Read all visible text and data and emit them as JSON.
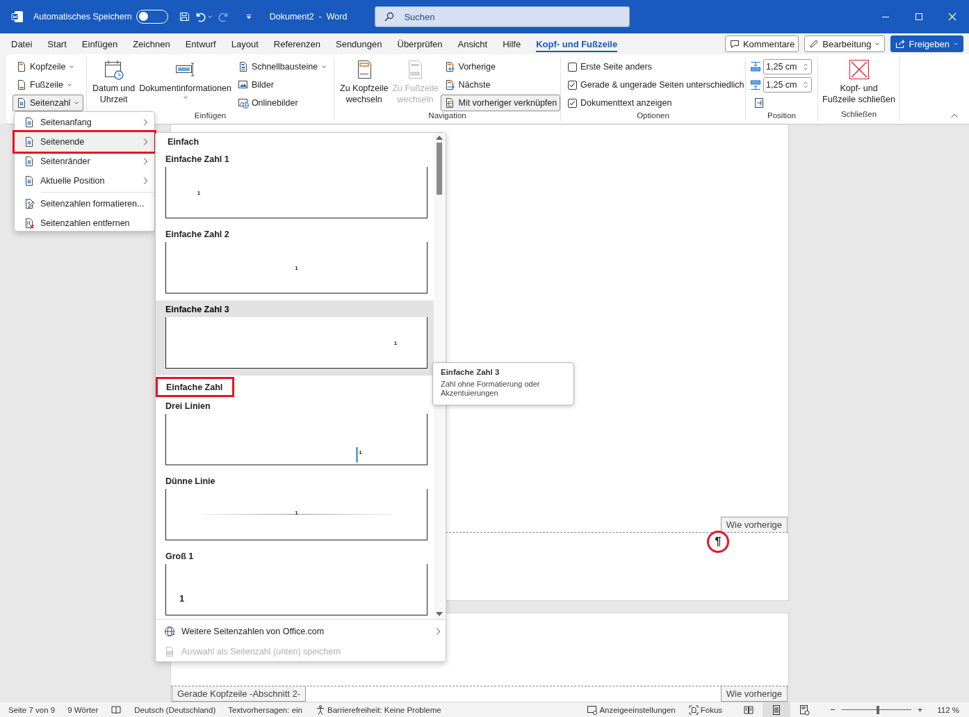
{
  "title_bar": {
    "autosave_label": "Automatisches Speichern",
    "autosave_on": false,
    "redo_disabled": true,
    "document_title": "Dokument2  -  Word",
    "search": {
      "placeholder": "Suchen"
    }
  },
  "ribbon_tabs": [
    {
      "label": "Datei",
      "selected": false
    },
    {
      "label": "Start",
      "selected": false
    },
    {
      "label": "Einfügen",
      "selected": false
    },
    {
      "label": "Zeichnen",
      "selected": false
    },
    {
      "label": "Entwurf",
      "selected": false
    },
    {
      "label": "Layout",
      "selected": false
    },
    {
      "label": "Referenzen",
      "selected": false
    },
    {
      "label": "Sendungen",
      "selected": false
    },
    {
      "label": "Überprüfen",
      "selected": false
    },
    {
      "label": "Ansicht",
      "selected": false
    },
    {
      "label": "Hilfe",
      "selected": false
    },
    {
      "label": "Kopf- und Fußzeile",
      "selected": true
    }
  ],
  "tab_buttons": [
    {
      "label": "Kommentare",
      "kind": "outline"
    },
    {
      "label": "Bearbeitung",
      "kind": "dropdown"
    },
    {
      "label": "Freigeben",
      "kind": "primary"
    }
  ],
  "ribbon_groups": [
    {
      "items": [
        {
          "kind": "small",
          "label": "Kopfzeile",
          "dropdown": true,
          "pressed": false
        },
        {
          "kind": "small",
          "label": "Fußzeile",
          "dropdown": true,
          "pressed": false
        },
        {
          "kind": "small",
          "label": "Seitenzahl",
          "dropdown": true,
          "pressed": true
        }
      ]
    },
    {
      "label": "Einfügen",
      "items": [
        {
          "kind": "large",
          "label": "Datum und\nUhrzeit",
          "dropdown": false,
          "disabled": false
        },
        {
          "kind": "large",
          "label": "Dokumentinformationen",
          "dropdown": true,
          "disabled": false
        },
        {
          "kind": "small",
          "label": "Schnellbausteine",
          "dropdown": true,
          "pressed": false
        },
        {
          "kind": "small",
          "label": "Bilder",
          "dropdown": false,
          "pressed": false
        },
        {
          "kind": "small",
          "label": "Onlinebilder",
          "dropdown": false,
          "pressed": false
        }
      ]
    },
    {
      "label": "Navigation",
      "items": [
        {
          "kind": "large",
          "label": "Zu Kopfzeile\nwechseln",
          "dropdown": false,
          "disabled": false
        },
        {
          "kind": "large",
          "label": "Zu Fußzeile\nwechseln",
          "dropdown": false,
          "disabled": true
        },
        {
          "kind": "small",
          "label": "Vorherige",
          "dropdown": false,
          "pressed": false
        },
        {
          "kind": "small",
          "label": "Nächste",
          "dropdown": false,
          "pressed": false
        },
        {
          "kind": "small",
          "label": "Mit vorheriger verknüpfen",
          "dropdown": false,
          "pressed": true
        }
      ]
    },
    {
      "label": "Optionen",
      "items": [
        {
          "kind": "checkbox",
          "label": "Erste Seite anders",
          "checked": false
        },
        {
          "kind": "checkbox",
          "label": "Gerade & ungerade Seiten unterschiedlich",
          "checked": true
        },
        {
          "kind": "checkbox",
          "label": "Dokumenttext anzeigen",
          "checked": true
        }
      ]
    },
    {
      "label": "Position",
      "items": [
        {
          "kind": "spinner",
          "value": "1,25 cm"
        },
        {
          "kind": "spinner",
          "value": "1,25 cm"
        },
        {
          "kind": "icon"
        }
      ]
    },
    {
      "label": "Schließen",
      "items": [
        {
          "kind": "large",
          "label": "Kopf- und\nFußzeile schließen",
          "dropdown": false,
          "disabled": false
        }
      ]
    }
  ],
  "seitenzahl_menu": {
    "items": [
      {
        "label": "Seitenanfang",
        "submenu": true,
        "highlighted": false,
        "marked": false
      },
      {
        "label": "Seitenende",
        "submenu": true,
        "highlighted": true,
        "marked": true
      },
      {
        "label": "Seitenränder",
        "submenu": true,
        "highlighted": false,
        "marked": false
      },
      {
        "label": "Aktuelle Position",
        "submenu": true,
        "highlighted": false,
        "marked": false
      },
      {
        "label": "Seitenzahlen formatieren...",
        "submenu": false,
        "highlighted": false,
        "marked": false
      },
      {
        "label": "Seitenzahlen entfernen",
        "submenu": false,
        "highlighted": false,
        "marked": false
      }
    ]
  },
  "gallery": {
    "sections": [
      {
        "heading": "Einfach",
        "marked": false,
        "items": [
          {
            "label": "Einfache Zahl 1",
            "kind": "plain-left",
            "number": "1",
            "hovered": false
          },
          {
            "label": "Einfache Zahl 2",
            "kind": "plain-center",
            "number": "1",
            "hovered": false
          },
          {
            "label": "Einfache Zahl 3",
            "kind": "plain-right",
            "number": "1",
            "hovered": true
          }
        ]
      },
      {
        "heading": "Einfache Zahl",
        "marked": true,
        "items": [
          {
            "label": "Drei Linien",
            "kind": "lines-right",
            "number": "1",
            "hovered": false
          },
          {
            "label": "Dünne Linie",
            "kind": "thin-center",
            "number": "1",
            "hovered": false
          },
          {
            "label": "Groß 1",
            "kind": "large-left",
            "number": "1",
            "hovered": false
          }
        ]
      }
    ],
    "footer": [
      {
        "label": "Weitere Seitenzahlen von Office.com",
        "disabled": false,
        "submenu": true
      },
      {
        "label": "Auswahl als Seitenzahl (unten) speichern",
        "disabled": true,
        "submenu": false
      }
    ]
  },
  "tooltip": {
    "title": "Einfache Zahl 3",
    "text": "Zahl ohne Formatierung oder Akzentuierungen"
  },
  "document": {
    "page_1": {
      "footer_tab": "Wie vorherige",
      "paragraph_mark": "¶",
      "mark_circled": true
    },
    "page_2": {
      "header_label": "Gerade Kopfzeile -Abschnitt 2-",
      "header_tab": "Wie vorherige"
    }
  },
  "status_bar": {
    "left": [
      {
        "kind": "text",
        "label": "Seite 7 von 9"
      },
      {
        "kind": "text",
        "label": "9 Wörter"
      },
      {
        "kind": "icon"
      },
      {
        "kind": "text",
        "label": "Deutsch (Deutschland)"
      },
      {
        "kind": "text",
        "label": "Textvorhersagen: ein"
      },
      {
        "kind": "icon_text",
        "label": "Barrierefreiheit: Keine Probleme"
      }
    ],
    "right": [
      {
        "kind": "icon_text",
        "label": "Anzeigeeinstellungen"
      },
      {
        "kind": "icon_text",
        "label": "Fokus"
      }
    ],
    "views": [
      {
        "selected": false
      },
      {
        "selected": true
      },
      {
        "selected": false
      }
    ],
    "zoom": {
      "minus": "−",
      "plus": "+",
      "level": 0.52,
      "reading": "112 %"
    }
  }
}
